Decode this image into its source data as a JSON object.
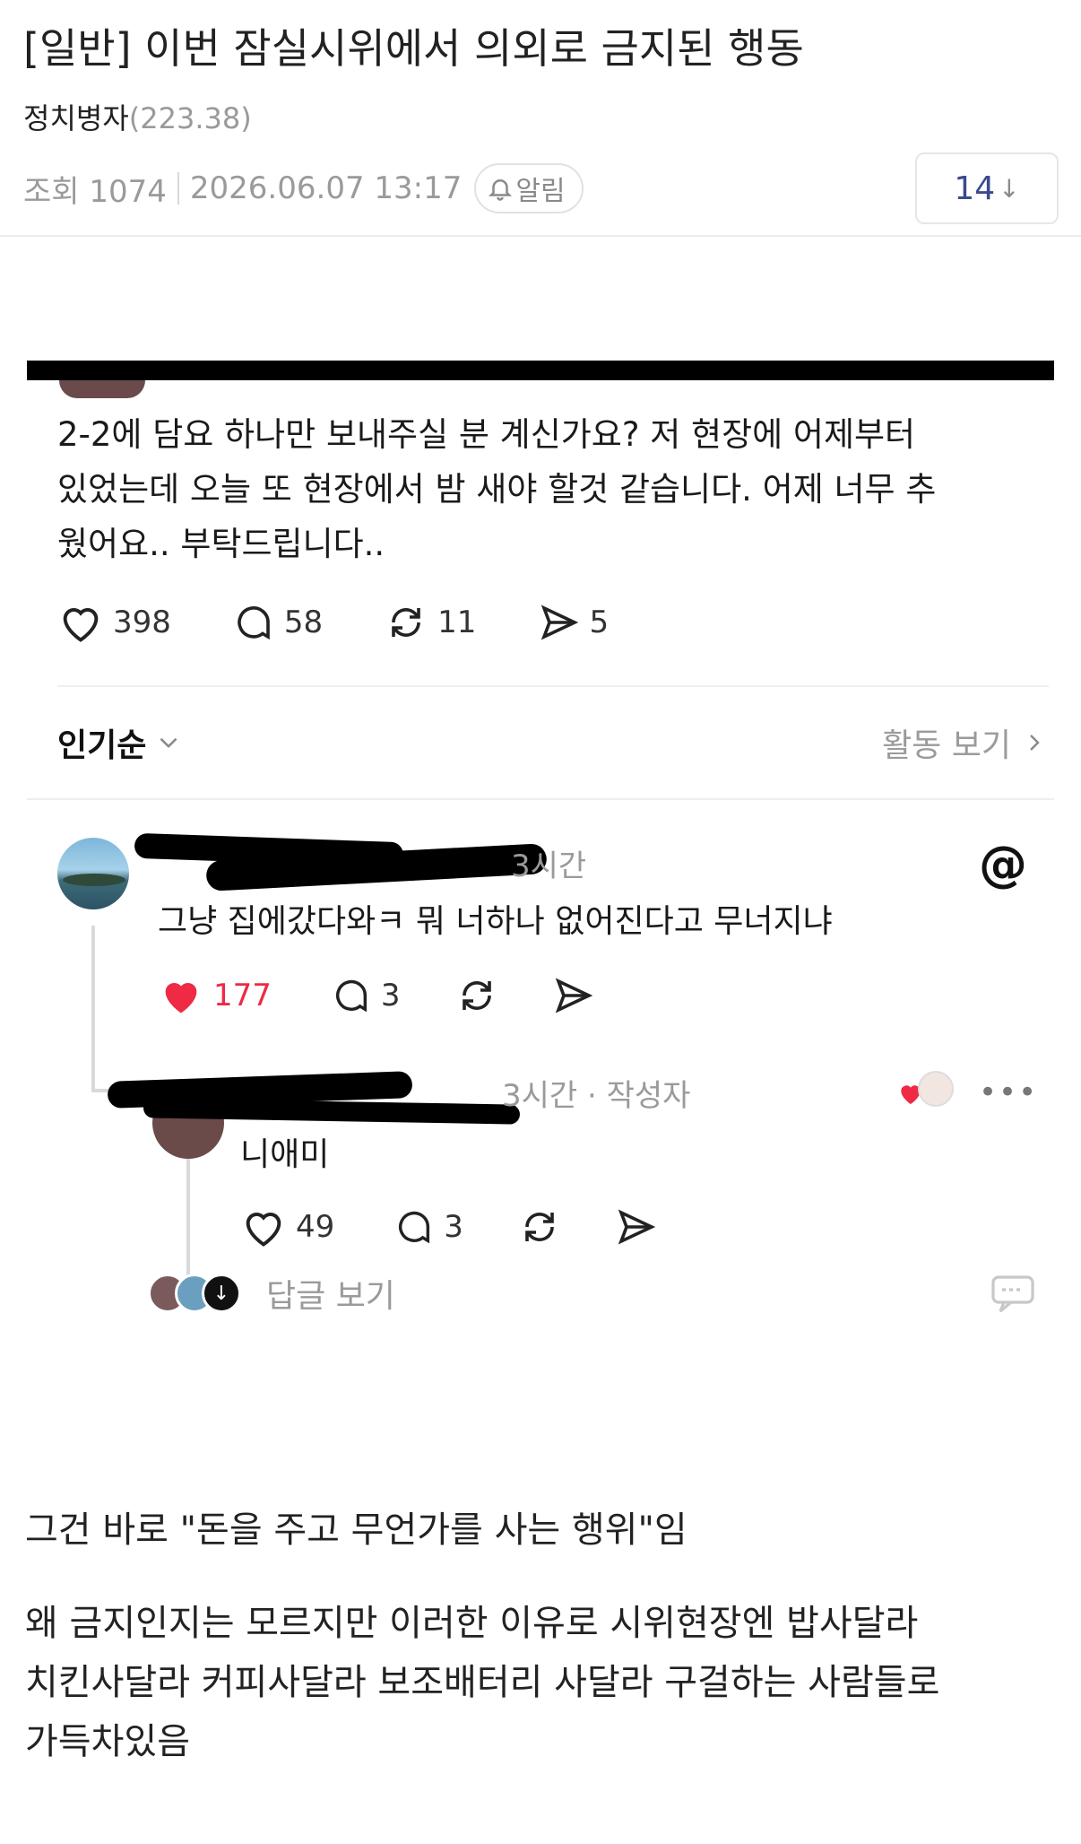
{
  "post": {
    "title": "[일반] 이번 잠실시위에서 의외로 금지된 행동",
    "author": "정치병자",
    "author_score": "(223.38)",
    "views": "조회 1074",
    "date": "2026.06.07 13:17",
    "alarm_label": "알림",
    "comment_count": "14",
    "comment_count_arrow": "↓"
  },
  "screenshot": {
    "post_text_lines": [
      "2-2에 담요 하나만 보내주실 분 계신가요? 저 현장에 어제부터",
      "있었는데 오늘 또 현장에서 밤 새야 할것 같습니다. 어제 너무 추",
      "웠어요.. 부탁드립니다.."
    ],
    "post_actions": {
      "likes": "398",
      "comments": "58",
      "reposts": "11",
      "shares": "5"
    },
    "sort_label": "인기순",
    "activity_link": "활동 보기",
    "comment1": {
      "time": "3시간",
      "text": "그냥 집에갔다와ㅋ 뭐 너하나 없어진다고 무너지냐",
      "likes": "177",
      "comments": "3"
    },
    "reply1": {
      "time": "3시간 · 작성자",
      "text": "니애미",
      "likes": "49",
      "comments": "3"
    },
    "view_replies": "답글 보기",
    "icons": [
      "heart-icon",
      "comment-icon",
      "repost-icon",
      "send-icon",
      "threads-logo-icon",
      "chat-bubble-icon"
    ],
    "colors": {
      "liked_heart": "#ee2a44",
      "muted": "#9a9a9a"
    }
  },
  "body": {
    "line1": "그건 바로 \"돈을 주고 무언가를 사는 행위\"임",
    "para2_lines": [
      "왜 금지인지는 모르지만 이러한 이유로 시위현장엔 밥사달라",
      "치킨사달라 커피사달라 보조배터리 사달라 구걸하는 사람들로",
      "가득차있음"
    ]
  }
}
